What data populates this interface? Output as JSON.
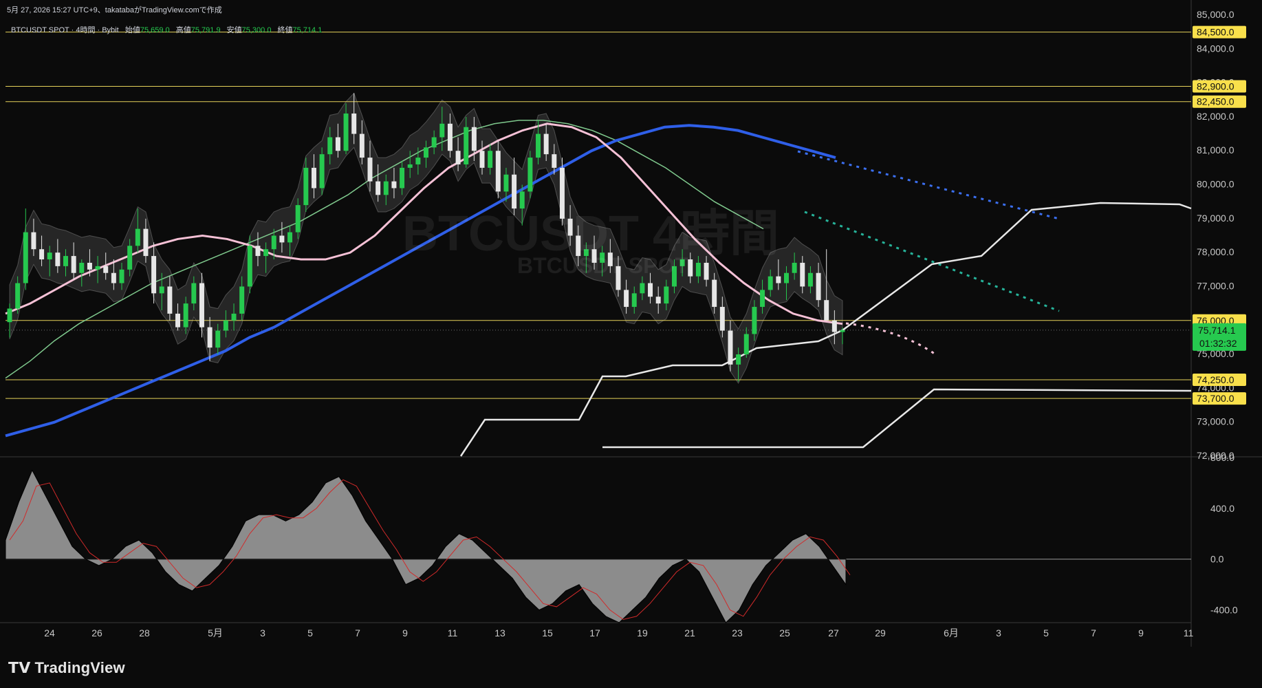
{
  "header": {
    "created_text": "5月 27, 2026 15:27 UTC+9、takatabaがTradingView.comで作成"
  },
  "legend": {
    "symbol_text": "BTCUSDT SPOT · 4時間 · Bybit",
    "open_label": "始値",
    "open_value": "75,659.0",
    "high_label": "高値",
    "high_value": "75,791.9",
    "low_label": "安値",
    "low_value": "75,300.0",
    "close_label": "終値",
    "close_value": "75,714.1"
  },
  "watermark": {
    "title": "BTCUSDT 4時間",
    "subtitle": "BTCUSDT SPOT"
  },
  "branding": {
    "logo_text": "TradingView"
  },
  "colors": {
    "background": "#0b0b0b",
    "up": "#26c94f",
    "down": "#e6e6e6",
    "ema_blue": "#2f5fe8",
    "pink_ma": "#f6c1d6",
    "green_ma": "#7fc98d",
    "bollinger": "#4a8ef0",
    "fast_purple": "#c57ee0",
    "projection_white": "#e8e8e8",
    "hline": "#e6d25a",
    "price_label_bg": "#f9e04b",
    "current_label_bg": "#26c94f",
    "teal_dots": "#26b39a"
  },
  "chart_data": [
    {
      "type": "candlestick",
      "title": "BTCUSDT SPOT · 4時間 · Bybit",
      "y_axis": {
        "ylim": [
          72000,
          85000
        ],
        "ticks": [
          72000,
          73000,
          74000,
          75000,
          76000,
          77000,
          78000,
          79000,
          80000,
          81000,
          82000,
          83000,
          84000,
          85000
        ]
      },
      "x_axis": {
        "ticks": [
          "24",
          "26",
          "28",
          "5月",
          "3",
          "5",
          "7",
          "9",
          "11",
          "13",
          "15",
          "17",
          "19",
          "21",
          "23",
          "25",
          "27",
          "29",
          "6月",
          "3",
          "5",
          "7",
          "9",
          "11"
        ]
      },
      "horizontal_levels": [
        84500,
        82900,
        82450,
        76000,
        74250,
        73700
      ],
      "price_labels": [
        "84,500.0",
        "82,900.0",
        "82,450.0",
        "76,000.0",
        "74,250.0",
        "73,700.0"
      ],
      "current_price": {
        "value": 75714.1,
        "label": "75,714.1",
        "countdown": "01:32:32"
      },
      "candles": [
        [
          "4/22",
          75950,
          76500,
          75500,
          76350
        ],
        [
          "4/22",
          76350,
          77300,
          76200,
          77100
        ],
        [
          "4/23",
          77100,
          79300,
          76900,
          78600
        ],
        [
          "4/23",
          78600,
          79000,
          77900,
          78100
        ],
        [
          "4/23",
          78100,
          78500,
          77600,
          77800
        ],
        [
          "4/24",
          77800,
          78200,
          77300,
          78000
        ],
        [
          "4/24",
          78000,
          78400,
          77400,
          77600
        ],
        [
          "4/24",
          77600,
          78100,
          77300,
          77900
        ],
        [
          "4/25",
          77900,
          78300,
          77200,
          77400
        ],
        [
          "4/25",
          77400,
          77800,
          77000,
          77700
        ],
        [
          "4/25",
          77700,
          78100,
          77300,
          77500
        ],
        [
          "4/26",
          77500,
          77900,
          77100,
          77600
        ],
        [
          "4/26",
          77600,
          78000,
          77200,
          77400
        ],
        [
          "4/26",
          77400,
          77800,
          76900,
          77100
        ],
        [
          "4/27",
          77100,
          77700,
          76900,
          77500
        ],
        [
          "4/27",
          77500,
          78400,
          77300,
          78200
        ],
        [
          "4/27",
          78200,
          79300,
          78000,
          78700
        ],
        [
          "4/28",
          78700,
          79000,
          77700,
          77900
        ],
        [
          "4/28",
          77900,
          78300,
          76500,
          76800
        ],
        [
          "4/28",
          76800,
          77400,
          76300,
          77000
        ],
        [
          "4/29",
          77000,
          77300,
          76000,
          76200
        ],
        [
          "4/29",
          76200,
          76500,
          75700,
          75800
        ],
        [
          "4/29",
          75800,
          76700,
          75600,
          76500
        ],
        [
          "4/30",
          76500,
          77300,
          76300,
          77100
        ],
        [
          "4/30",
          77100,
          77400,
          75500,
          75800
        ],
        [
          "4/30",
          75800,
          76100,
          74800,
          75200
        ],
        [
          "5/1",
          75200,
          75900,
          75000,
          75700
        ],
        [
          "5/1",
          75700,
          76300,
          75500,
          76000
        ],
        [
          "5/1",
          76000,
          76500,
          75700,
          76200
        ],
        [
          "5/2",
          76200,
          77300,
          76000,
          77000
        ],
        [
          "5/2",
          77000,
          78500,
          76800,
          78200
        ],
        [
          "5/2",
          78200,
          78600,
          77600,
          77900
        ],
        [
          "5/3",
          77900,
          78300,
          77400,
          78100
        ],
        [
          "5/3",
          78100,
          78700,
          77800,
          78500
        ],
        [
          "5/3",
          78500,
          78900,
          78000,
          78300
        ],
        [
          "5/4",
          78300,
          78800,
          77900,
          78600
        ],
        [
          "5/4",
          78600,
          79600,
          78400,
          79400
        ],
        [
          "5/4",
          79400,
          80800,
          79200,
          80500
        ],
        [
          "5/5",
          80500,
          80900,
          79600,
          79900
        ],
        [
          "5/5",
          79900,
          81100,
          79700,
          80900
        ],
        [
          "5/5",
          80900,
          81700,
          80600,
          81400
        ],
        [
          "5/6",
          81400,
          81800,
          80800,
          81000
        ],
        [
          "5/6",
          81000,
          82400,
          80900,
          82100
        ],
        [
          "5/6",
          82100,
          82700,
          81200,
          81500
        ],
        [
          "5/7",
          81500,
          81900,
          80600,
          80800
        ],
        [
          "5/7",
          80800,
          81300,
          79800,
          80100
        ],
        [
          "5/7",
          80100,
          80600,
          79500,
          79700
        ],
        [
          "5/8",
          79700,
          80300,
          79400,
          80100
        ],
        [
          "5/8",
          80100,
          80500,
          79600,
          79900
        ],
        [
          "5/8",
          79900,
          80700,
          79700,
          80500
        ],
        [
          "5/9",
          80500,
          81000,
          80200,
          80600
        ],
        [
          "5/9",
          80600,
          81100,
          80300,
          80800
        ],
        [
          "5/10",
          80800,
          81300,
          80500,
          81100
        ],
        [
          "5/10",
          81100,
          81600,
          80900,
          81400
        ],
        [
          "5/10",
          81400,
          82300,
          81000,
          81800
        ],
        [
          "5/11",
          81800,
          82100,
          80800,
          81000
        ],
        [
          "5/11",
          81000,
          81400,
          80400,
          80600
        ],
        [
          "5/11",
          80600,
          82000,
          80500,
          81700
        ],
        [
          "5/12",
          81700,
          82000,
          80700,
          81000
        ],
        [
          "5/12",
          81000,
          81300,
          80300,
          80500
        ],
        [
          "5/12",
          80500,
          81200,
          80300,
          81000
        ],
        [
          "5/13",
          81000,
          81300,
          79600,
          79800
        ],
        [
          "5/13",
          79800,
          80500,
          79500,
          80300
        ],
        [
          "5/13",
          80300,
          80800,
          79100,
          79300
        ],
        [
          "5/14",
          79300,
          80000,
          78800,
          79800
        ],
        [
          "5/14",
          79800,
          81000,
          79600,
          80800
        ],
        [
          "5/14",
          80800,
          81900,
          80600,
          81500
        ],
        [
          "5/15",
          81500,
          81800,
          80700,
          80900
        ],
        [
          "5/15",
          80900,
          81200,
          80300,
          80500
        ],
        [
          "5/15",
          80500,
          80800,
          78800,
          79000
        ],
        [
          "5/16",
          79000,
          79400,
          78200,
          78500
        ],
        [
          "5/16",
          78500,
          78800,
          77600,
          77900
        ],
        [
          "5/16",
          77900,
          78300,
          77400,
          78100
        ],
        [
          "5/17",
          78100,
          78500,
          77500,
          77700
        ],
        [
          "5/17",
          77700,
          78200,
          77300,
          78000
        ],
        [
          "5/17",
          78000,
          78400,
          77400,
          77600
        ],
        [
          "5/18",
          77600,
          77900,
          76700,
          76900
        ],
        [
          "5/18",
          76900,
          77200,
          76200,
          76400
        ],
        [
          "5/18",
          76400,
          77000,
          76200,
          76800
        ],
        [
          "5/19",
          76800,
          77300,
          76600,
          77100
        ],
        [
          "5/19",
          77100,
          77400,
          76500,
          76700
        ],
        [
          "5/19",
          76700,
          77000,
          76200,
          76500
        ],
        [
          "5/20",
          76500,
          77200,
          76300,
          77000
        ],
        [
          "5/20",
          77000,
          77800,
          76800,
          77600
        ],
        [
          "5/20",
          77600,
          78100,
          77300,
          77800
        ],
        [
          "5/21",
          77800,
          78000,
          77100,
          77300
        ],
        [
          "5/21",
          77300,
          77900,
          77100,
          77700
        ],
        [
          "5/21",
          77700,
          77900,
          77000,
          77200
        ],
        [
          "5/22",
          77200,
          77400,
          76200,
          76400
        ],
        [
          "5/22",
          76400,
          76700,
          75500,
          75700
        ],
        [
          "5/22",
          75700,
          76000,
          74500,
          74700
        ],
        [
          "5/23",
          74700,
          75200,
          74200,
          75000
        ],
        [
          "5/23",
          75000,
          75800,
          74900,
          75600
        ],
        [
          "5/23",
          75600,
          76600,
          75400,
          76400
        ],
        [
          "5/24",
          76400,
          77200,
          76200,
          76900
        ],
        [
          "5/24",
          76900,
          77500,
          76700,
          77300
        ],
        [
          "5/24",
          77300,
          77800,
          76900,
          77100
        ],
        [
          "5/25",
          77100,
          77600,
          76600,
          77400
        ],
        [
          "5/25",
          77400,
          78000,
          77200,
          77700
        ],
        [
          "5/25",
          77700,
          77900,
          76800,
          77000
        ],
        [
          "5/26",
          77000,
          77600,
          76800,
          77400
        ],
        [
          "5/26",
          77400,
          77700,
          76400,
          76600
        ],
        [
          "5/26",
          76600,
          78100,
          76300,
          76000
        ],
        [
          "5/27",
          76000,
          76300,
          75300,
          75660
        ],
        [
          "5/27",
          75659,
          75792,
          75300,
          75714
        ]
      ],
      "series": [
        {
          "type": "ema",
          "values": [
            72600,
            72800,
            73000,
            73300,
            73600,
            73900,
            74200,
            74500,
            74800,
            75100,
            75500,
            75800,
            76200,
            76600,
            77000,
            77400,
            77800,
            78200,
            78600,
            79000,
            79400,
            79800,
            80200,
            80600,
            81000,
            81300,
            81500,
            81700,
            81750,
            81700,
            81600,
            81400,
            81200,
            81000,
            80800
          ]
        },
        {
          "type": "ma",
          "values": [
            76200,
            76500,
            76900,
            77300,
            77600,
            77900,
            78200,
            78400,
            78500,
            78400,
            78200,
            77900,
            77800,
            77800,
            78000,
            78500,
            79200,
            79900,
            80500,
            80900,
            81300,
            81600,
            81800,
            81700,
            81400,
            80800,
            80000,
            79200,
            78400,
            77700,
            77100,
            76600,
            76200,
            76000,
            75900
          ]
        },
        {
          "type": "ma",
          "values": [
            74300,
            74800,
            75400,
            75900,
            76300,
            76700,
            77100,
            77400,
            77700,
            78000,
            78300,
            78600,
            78900,
            79300,
            79700,
            80200,
            80600,
            81000,
            81300,
            81600,
            81800,
            81900,
            81900,
            81800,
            81600,
            81300,
            80900,
            80500,
            80000,
            79500,
            79100,
            78700
          ]
        }
      ]
    },
    {
      "type": "area",
      "title": "",
      "y_axis": {
        "ylim": [
          -500,
          800
        ],
        "ticks": [
          800,
          400,
          0,
          -400
        ],
        "tick_labels": [
          "800.0",
          "400.0",
          "0.0",
          "-400.0"
        ]
      },
      "values": [
        150,
        450,
        700,
        500,
        300,
        100,
        0,
        -50,
        0,
        100,
        150,
        50,
        -100,
        -200,
        -250,
        -150,
        -50,
        100,
        300,
        350,
        350,
        300,
        350,
        450,
        600,
        650,
        500,
        300,
        150,
        0,
        -200,
        -150,
        -50,
        100,
        200,
        150,
        50,
        -50,
        -150,
        -300,
        -400,
        -350,
        -250,
        -200,
        -350,
        -450,
        -500,
        -400,
        -300,
        -150,
        -50,
        0,
        -100,
        -300,
        -500,
        -400,
        -200,
        -50,
        50,
        150,
        200,
        100,
        -50,
        -200
      ]
    }
  ]
}
